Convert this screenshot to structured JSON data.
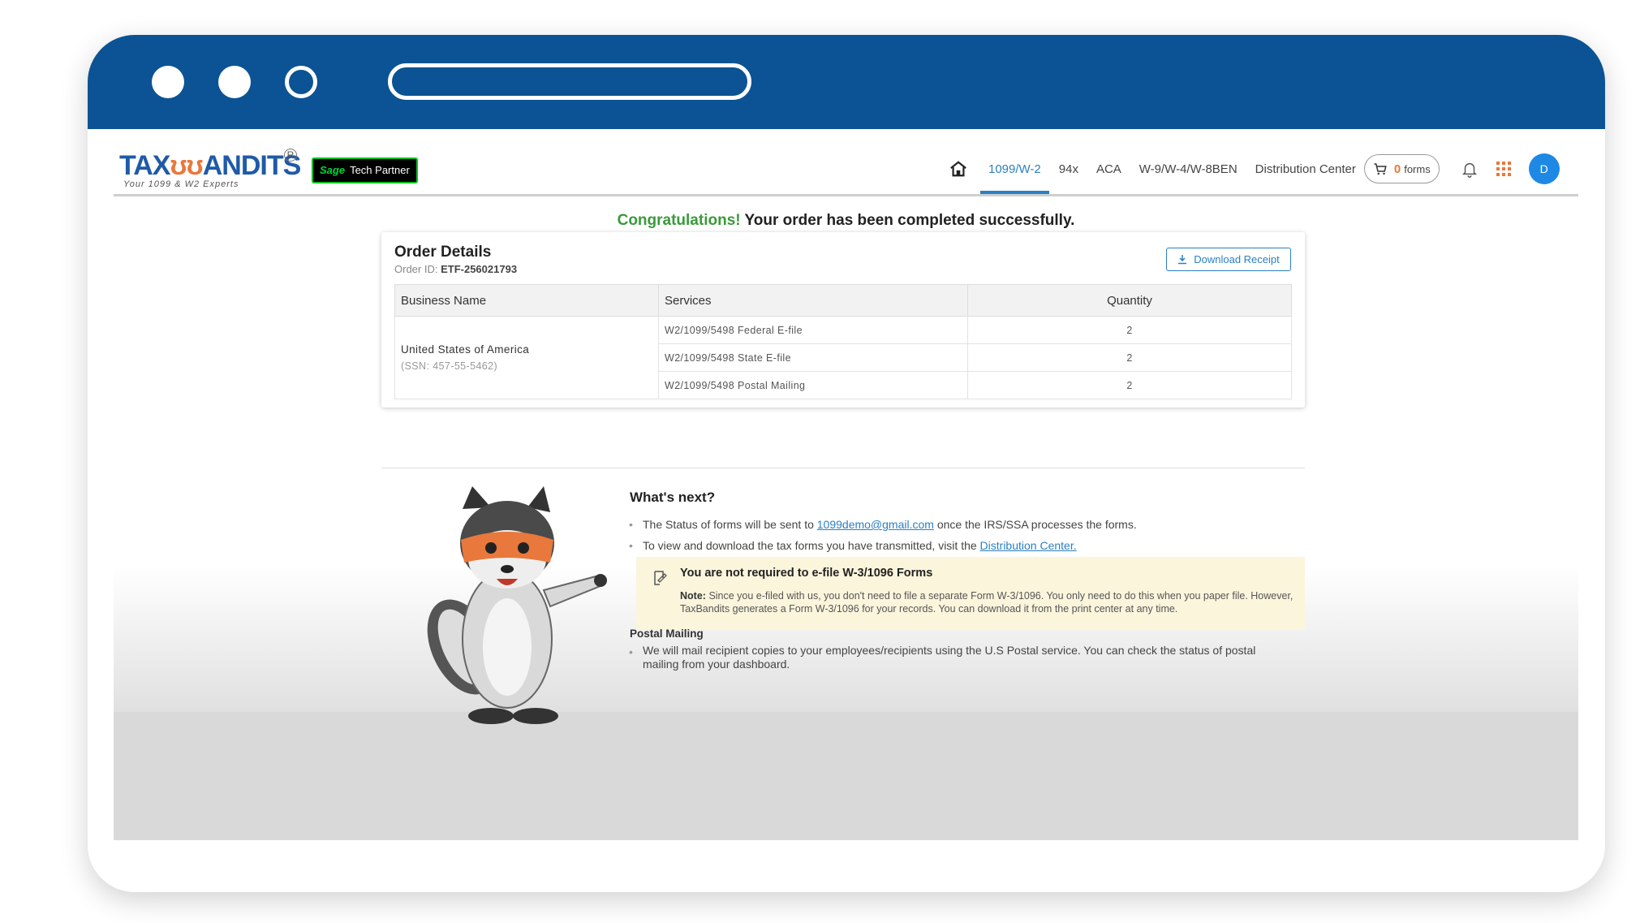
{
  "nav": {
    "logo_text_left": "TAX",
    "logo_text_right": "ANDITS",
    "tagline": "Your 1099 & W2 Experts",
    "partner_badge_brand": "Sage",
    "partner_badge_text": "Tech Partner",
    "items": [
      "1099/W-2",
      "94x",
      "ACA",
      "W-9/W-4/W-8BEN",
      "Distribution Center"
    ],
    "cart_count": "0",
    "cart_label": "forms",
    "avatar_initial": "D"
  },
  "banner": {
    "congrats": "Congratulations!",
    "message": "Your order has been completed successfully."
  },
  "order": {
    "title": "Order Details",
    "order_id_label": "Order ID:",
    "order_id": "ETF-256021793",
    "download_label": "Download Receipt",
    "columns": [
      "Business Name",
      "Services",
      "Quantity"
    ],
    "business_name": "United States of America",
    "ssn": "(SSN: 457-55-5462)",
    "rows": [
      {
        "service": "W2/1099/5498 Federal E-file",
        "quantity": "2"
      },
      {
        "service": "W2/1099/5498 State E-file",
        "quantity": "2"
      },
      {
        "service": "W2/1099/5498 Postal Mailing",
        "quantity": "2"
      }
    ]
  },
  "next": {
    "heading": "What's next?",
    "b1_pre": "The Status of forms will be sent to",
    "b1_email": "1099demo@gmail.com",
    "b1_post": "once the IRS/SSA processes the forms.",
    "b2_pre": "To view and download the tax forms you have transmitted, visit the",
    "b2_link": "Distribution Center."
  },
  "notice": {
    "title": "You are not required to e-file W-3/1096 Forms",
    "note_label": "Note:",
    "note_text": "Since you e-filed with us, you don't need to file a separate Form W-3/1096. You only need to do this when you paper file. However, TaxBandits generates a Form W-3/1096 for your records. You can download it from the print center at any time."
  },
  "postal": {
    "heading": "Postal Mailing",
    "text": "We will mail recipient copies to your employees/recipients using the U.S Postal service. You can check the status of postal mailing from your dashboard."
  },
  "colors": {
    "window_bar": "#0b5394",
    "accent": "#2a7fc4",
    "congrats_green": "#3a9a3a",
    "notice_bg": "#fbf5dc"
  }
}
